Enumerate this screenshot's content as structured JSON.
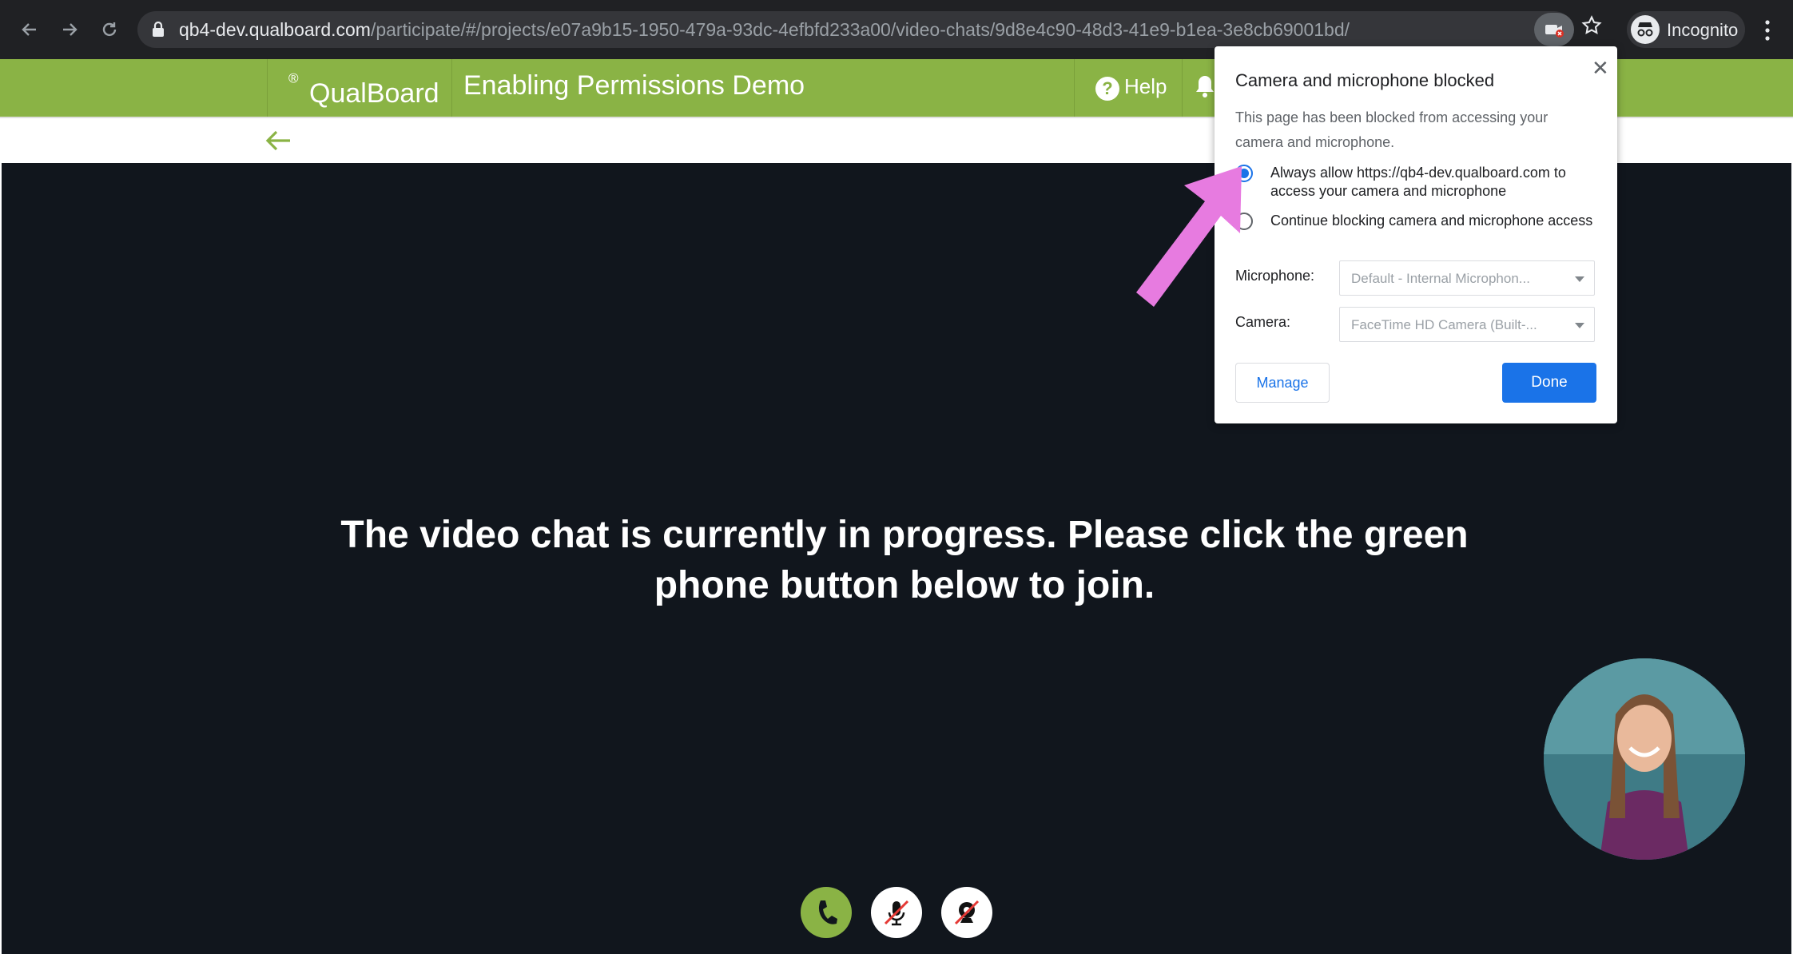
{
  "browser": {
    "url_host": "qb4-dev.qualboard.com",
    "url_path": "/participate/#/projects/e07a9b15-1950-479a-93dc-4efbfd233a00/video-chats/9d8e4c90-48d3-41e9-b1ea-3e8cb69001bd/",
    "profile_label": "Incognito"
  },
  "header": {
    "logo": "QualBoard",
    "logo_mark": "®",
    "page_title": "Enabling Permissions Demo",
    "help_label": "Help"
  },
  "video": {
    "message": "The video chat is currently in progress. Please click the green phone button below to join."
  },
  "popup": {
    "title": "Camera and microphone blocked",
    "description": "This page has been blocked from accessing your camera and microphone.",
    "options": [
      {
        "label": "Always allow https://qb4-dev.qualboard.com to access your camera and microphone",
        "selected": true
      },
      {
        "label": "Continue blocking camera and microphone access",
        "selected": false
      }
    ],
    "microphone_label": "Microphone:",
    "microphone_value": "Default - Internal Microphon...",
    "camera_label": "Camera:",
    "camera_value": "FaceTime HD Camera (Built-...",
    "manage_label": "Manage",
    "done_label": "Done"
  },
  "colors": {
    "brand_green": "#8ab345",
    "video_bg": "#11161d",
    "accent_blue": "#1a73e8",
    "annotation_pink": "#e77be0"
  }
}
